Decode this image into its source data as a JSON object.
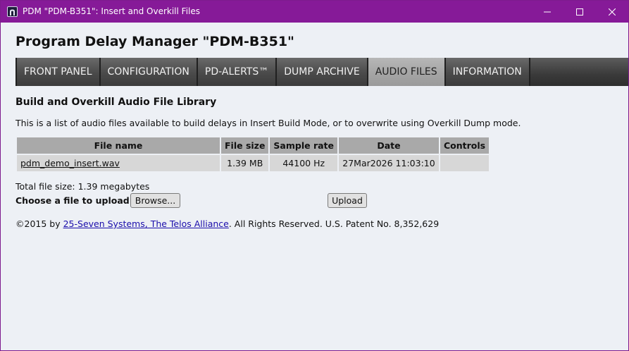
{
  "window": {
    "title": "PDM \"PDM-B351\": Insert and Overkill Files",
    "titlebar_color": "#861a98",
    "controls": {
      "minimize_icon": "minimize-icon",
      "maximize_icon": "maximize-icon",
      "close_icon": "close-icon"
    }
  },
  "page": {
    "title": "Program Delay Manager \"PDM-B351\""
  },
  "nav": {
    "tabs": [
      {
        "label": "FRONT PANEL",
        "active": false
      },
      {
        "label": "CONFIGURATION",
        "active": false
      },
      {
        "label": "PD-ALERTS™",
        "active": false
      },
      {
        "label": "DUMP ARCHIVE",
        "active": false
      },
      {
        "label": "AUDIO FILES",
        "active": true
      },
      {
        "label": "INFORMATION",
        "active": false
      }
    ]
  },
  "library": {
    "title": "Build and Overkill Audio File Library",
    "description": "This is a list of audio files available to build delays in Insert Build Mode, or to overwrite using Overkill Dump mode.",
    "columns": [
      "File name",
      "File size",
      "Sample rate",
      "Date",
      "Controls"
    ],
    "rows": [
      {
        "file_name": "pdm_demo_insert.wav",
        "file_size": "1.39 MB",
        "sample_rate": "44100 Hz",
        "date": "27Mar2026 11:03:10",
        "controls": ""
      }
    ],
    "total": "Total file size: 1.39 megabytes"
  },
  "upload": {
    "label": "Choose a file to upload:",
    "browse_label": "Browse...",
    "upload_label": "Upload"
  },
  "footer": {
    "prefix": "©2015 by ",
    "link_text": "25-Seven Systems, The Telos Alliance",
    "suffix": ".  All Rights Reserved.  U.S. Patent No. 8,352,629"
  }
}
